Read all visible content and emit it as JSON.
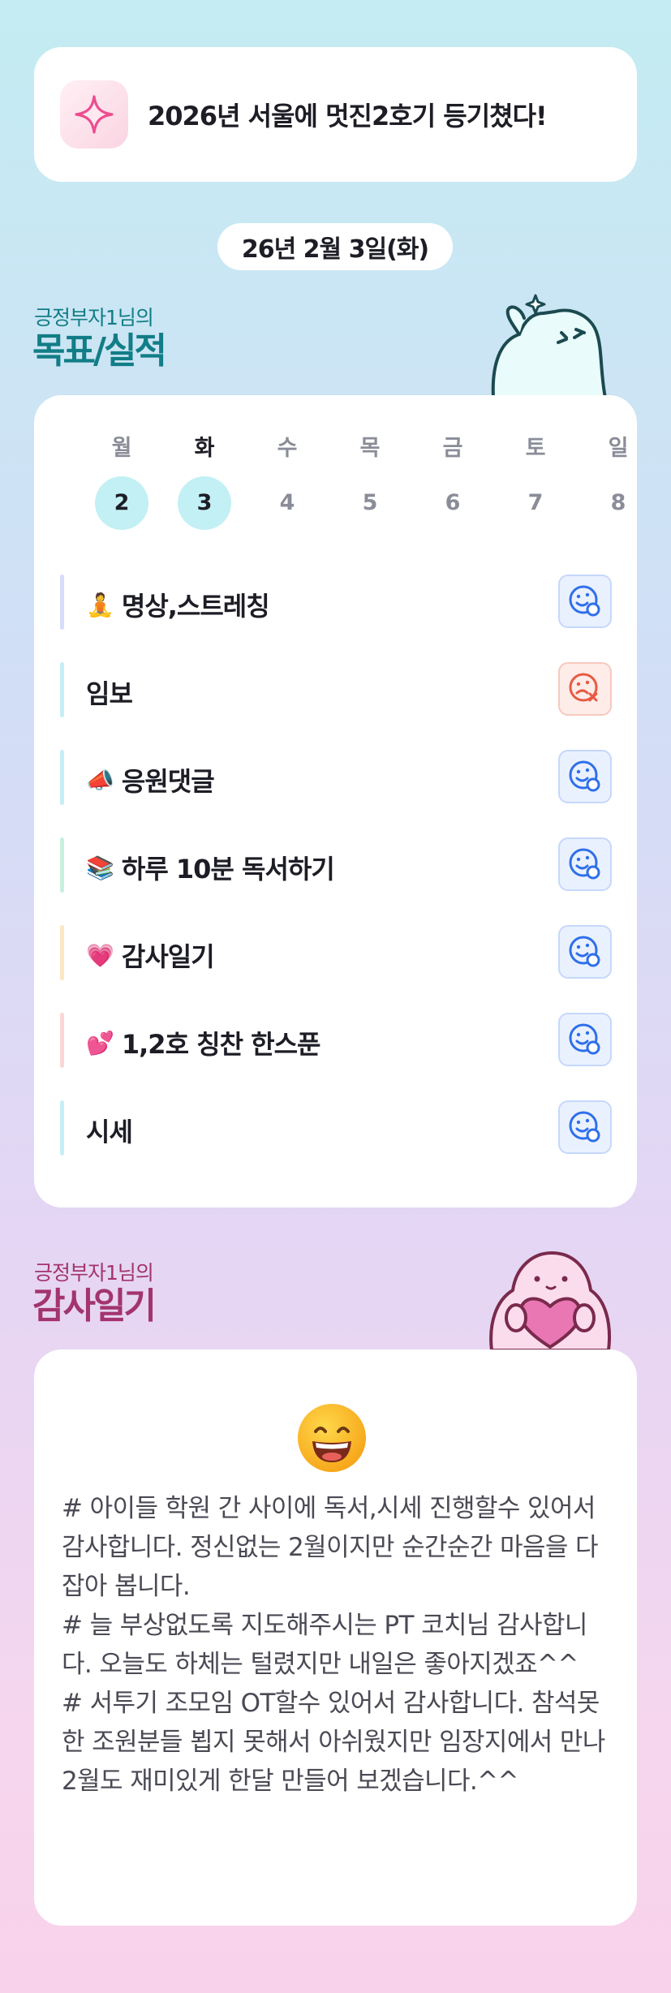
{
  "goal_banner": {
    "icon": "sparkle-icon",
    "text": "2026년 서울에 멋진2호기 등기쳤다!"
  },
  "date": "26년 2월 3일(화)",
  "goals_section": {
    "subtitle": "긍정부자1님의",
    "title": "목표/실적"
  },
  "week": [
    {
      "day": "월",
      "num": "2",
      "done": true,
      "today": false
    },
    {
      "day": "화",
      "num": "3",
      "done": true,
      "today": true
    },
    {
      "day": "수",
      "num": "4",
      "done": false,
      "today": false
    },
    {
      "day": "목",
      "num": "5",
      "done": false,
      "today": false
    },
    {
      "day": "금",
      "num": "6",
      "done": false,
      "today": false
    },
    {
      "day": "토",
      "num": "7",
      "done": false,
      "today": false
    },
    {
      "day": "일",
      "num": "8",
      "done": false,
      "today": false
    }
  ],
  "tasks": [
    {
      "emoji": "🧘",
      "label": "명상,스트레칭",
      "status": "done",
      "bar_color": "#d7dcfb"
    },
    {
      "emoji": "",
      "label": "임보",
      "status": "missed",
      "bar_color": "#c6eef6"
    },
    {
      "emoji": "📣",
      "label": "응원댓글",
      "status": "done",
      "bar_color": "#c6eef6"
    },
    {
      "emoji": "📚",
      "label": "하루 10분 독서하기",
      "status": "done",
      "bar_color": "#c7f0de"
    },
    {
      "emoji": "💗",
      "label": "감사일기",
      "status": "done",
      "bar_color": "#fbe7c4"
    },
    {
      "emoji": "💕",
      "label": "1,2호 칭찬 한스푼",
      "status": "done",
      "bar_color": "#fbd6d6"
    },
    {
      "emoji": "",
      "label": "시세",
      "status": "done",
      "bar_color": "#c6eef6"
    }
  ],
  "diary_section": {
    "subtitle": "긍정부자1님의",
    "title": "감사일기"
  },
  "diary": {
    "mood_icon": "grinning-face-icon",
    "text": "# 아이들 학원 간 사이에 독서,시세 진행할수 있어서 감사합니다. 정신없는 2월이지만 순간순간 마음을 다잡아 봅니다.\n# 늘 부상없도록 지도해주시는 PT 코치님 감사합니다. 오늘도 하체는 털렸지만 내일은 좋아지겠죠^^\n# 서투기 조모임 OT할수 있어서 감사합니다. 참석못한 조원분들 뵙지 못해서 아쉬웠지만 임장지에서 만나 2월도 재미있게 한달 만들어 보겠습니다.^^"
  },
  "colors": {
    "accent_teal": "#127d86",
    "accent_plum": "#a3346e",
    "done_day": "#c3f0f4",
    "face_ok": "#2f6fea",
    "face_bad": "#e85a43"
  }
}
